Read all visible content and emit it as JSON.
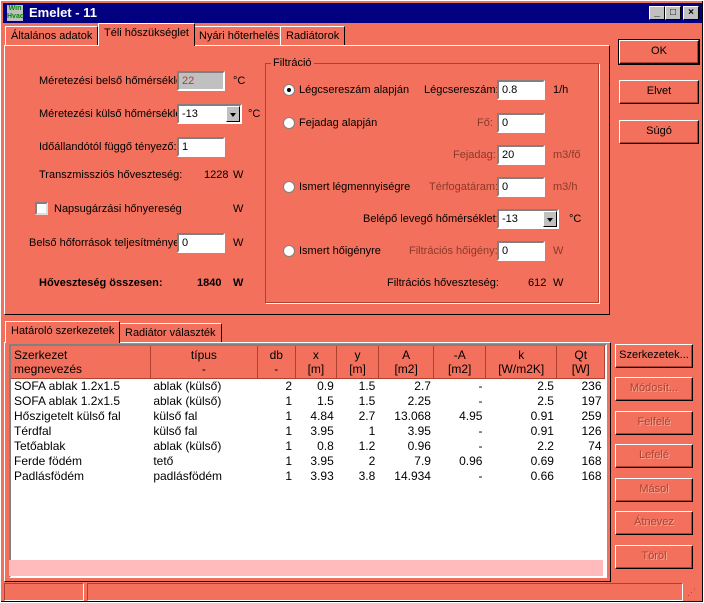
{
  "window": {
    "title": "Emelet - 11"
  },
  "tabs": [
    "Általános adatok",
    "Téli hőszükséglet",
    "Nyári hőterhelés",
    "Radiátorok"
  ],
  "left": {
    "indoor_label": "Méretezési belső hőmérséklet:",
    "indoor_value": "22",
    "indoor_unit": "°C",
    "outdoor_label": "Méretezési külső hőmérséklet:",
    "outdoor_value": "-13",
    "outdoor_unit": "°C",
    "time_label": "Időállandótól függő tényező:",
    "time_value": "1",
    "trans_label": "Transzmissziós hőveszteség:",
    "trans_value": "1228",
    "trans_unit": "W",
    "sun_label": "Napsugárzási hőnyereség",
    "sun_unit": "W",
    "internal_label": "Belső hőforrások teljesítménye:",
    "internal_value": "0",
    "internal_unit": "W",
    "total_label": "Hőveszteség összesen:",
    "total_value": "1840",
    "total_unit": "W"
  },
  "filtration": {
    "title": "Filtráció",
    "opt1": "Légcsereszám alapján",
    "air_change_label": "Légcsereszám:",
    "air_change_value": "0.8",
    "air_change_unit": "1/h",
    "opt2": "Fejadag alapján",
    "persons_label": "Fő:",
    "persons_value": "0",
    "ration_label": "Fejadag:",
    "ration_value": "20",
    "ration_unit": "m3/fő",
    "opt3": "Ismert légmennyiségre",
    "flow_label": "Térfogatáram:",
    "flow_value": "0",
    "flow_unit": "m3/h",
    "inlet_label": "Belépő levegő hőmérséklet:",
    "inlet_value": "-13",
    "inlet_unit": "°C",
    "opt4": "Ismert hőigényre",
    "filt_heat_label": "Filtrációs hőigény:",
    "filt_heat_value": "0",
    "filt_heat_unit": "W",
    "loss_label": "Filtrációs hőveszteség:",
    "loss_value": "612",
    "loss_unit": "W"
  },
  "buttons": {
    "ok": "OK",
    "cancel": "Elvet",
    "help": "Súgó"
  },
  "lower_tabs": [
    "Határoló szerkezetek",
    "Radiátor választék"
  ],
  "side_buttons": [
    "Szerkezetek...",
    "Módosít...",
    "Felfelé",
    "Lefelé",
    "Másol",
    "Átnevez",
    "Töröl"
  ],
  "table": {
    "headers": [
      [
        "Szerkezet",
        "megnevezés"
      ],
      [
        "típus",
        "-"
      ],
      [
        "db",
        "-"
      ],
      [
        "x",
        "[m]"
      ],
      [
        "y",
        "[m]"
      ],
      [
        "A",
        "[m2]"
      ],
      [
        "-A",
        "[m2]"
      ],
      [
        "k",
        "[W/m2K]"
      ],
      [
        "Qt",
        "[W]"
      ]
    ],
    "rows": [
      [
        "SOFA ablak 1.2x1.5",
        "ablak (külső)",
        "2",
        "0.9",
        "1.5",
        "2.7",
        "-",
        "2.5",
        "236"
      ],
      [
        "SOFA ablak 1.2x1.5",
        "ablak (külső)",
        "1",
        "1.5",
        "1.5",
        "2.25",
        "-",
        "2.5",
        "197"
      ],
      [
        "Hőszigetelt külső fal",
        "külső fal",
        "1",
        "4.84",
        "2.7",
        "13.068",
        "4.95",
        "0.91",
        "259"
      ],
      [
        "Térdfal",
        "külső fal",
        "1",
        "3.95",
        "1",
        "3.95",
        "-",
        "0.91",
        "126"
      ],
      [
        "Tetőablak",
        "ablak (külső)",
        "1",
        "0.8",
        "1.2",
        "0.96",
        "-",
        "2.2",
        "74"
      ],
      [
        "Ferde födém",
        "tető",
        "1",
        "3.95",
        "2",
        "7.9",
        "0.96",
        "0.69",
        "168"
      ],
      [
        "Padlásfödém",
        "padlásfödém",
        "1",
        "3.93",
        "3.8",
        "14.934",
        "-",
        "0.66",
        "168"
      ]
    ]
  }
}
